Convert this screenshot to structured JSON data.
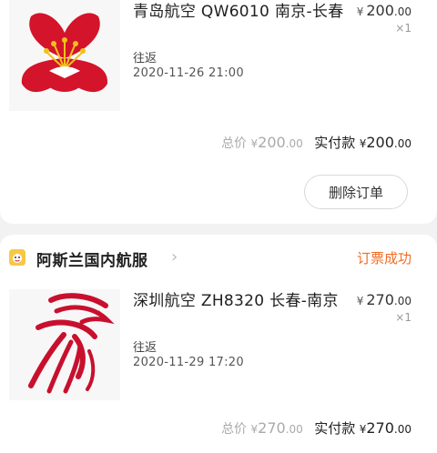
{
  "orders": [
    {
      "title": "青岛航空 QW6010 南京-长春",
      "price_yen": "¥",
      "price_int": "200",
      "price_dec": ".00",
      "qty": "×1",
      "trip_type": "往返",
      "datetime": "2020-11-26 21:00",
      "total_label": "总价",
      "total_yen": "¥",
      "total_int": "200",
      "total_dec": ".00",
      "paid_label": "实付款",
      "paid_yen": "¥",
      "paid_int": "200",
      "paid_dec": ".00",
      "delete_label": "删除订单"
    },
    {
      "shop_name": "阿斯兰国内航服",
      "status": "订票成功",
      "title": "深圳航空 ZH8320 长春-南京",
      "price_yen": "¥",
      "price_int": "270",
      "price_dec": ".00",
      "qty": "×1",
      "trip_type": "往返",
      "datetime": "2020-11-29 17:20",
      "total_label": "总价",
      "total_yen": "¥",
      "total_int": "270",
      "total_dec": ".00",
      "paid_label": "实付款",
      "paid_yen": "¥",
      "paid_int": "270",
      "paid_dec": ".00"
    }
  ],
  "colors": {
    "status": "#f26b22",
    "qingdao_red": "#d3142b",
    "shenzhen_red": "#c8102e"
  },
  "icons": {
    "order1_logo": "qingdao-airlines-flower-logo",
    "order2_logo": "shenzhen-airlines-bird-logo",
    "shop": "shop-icon",
    "chevron": "chevron-right-icon"
  }
}
